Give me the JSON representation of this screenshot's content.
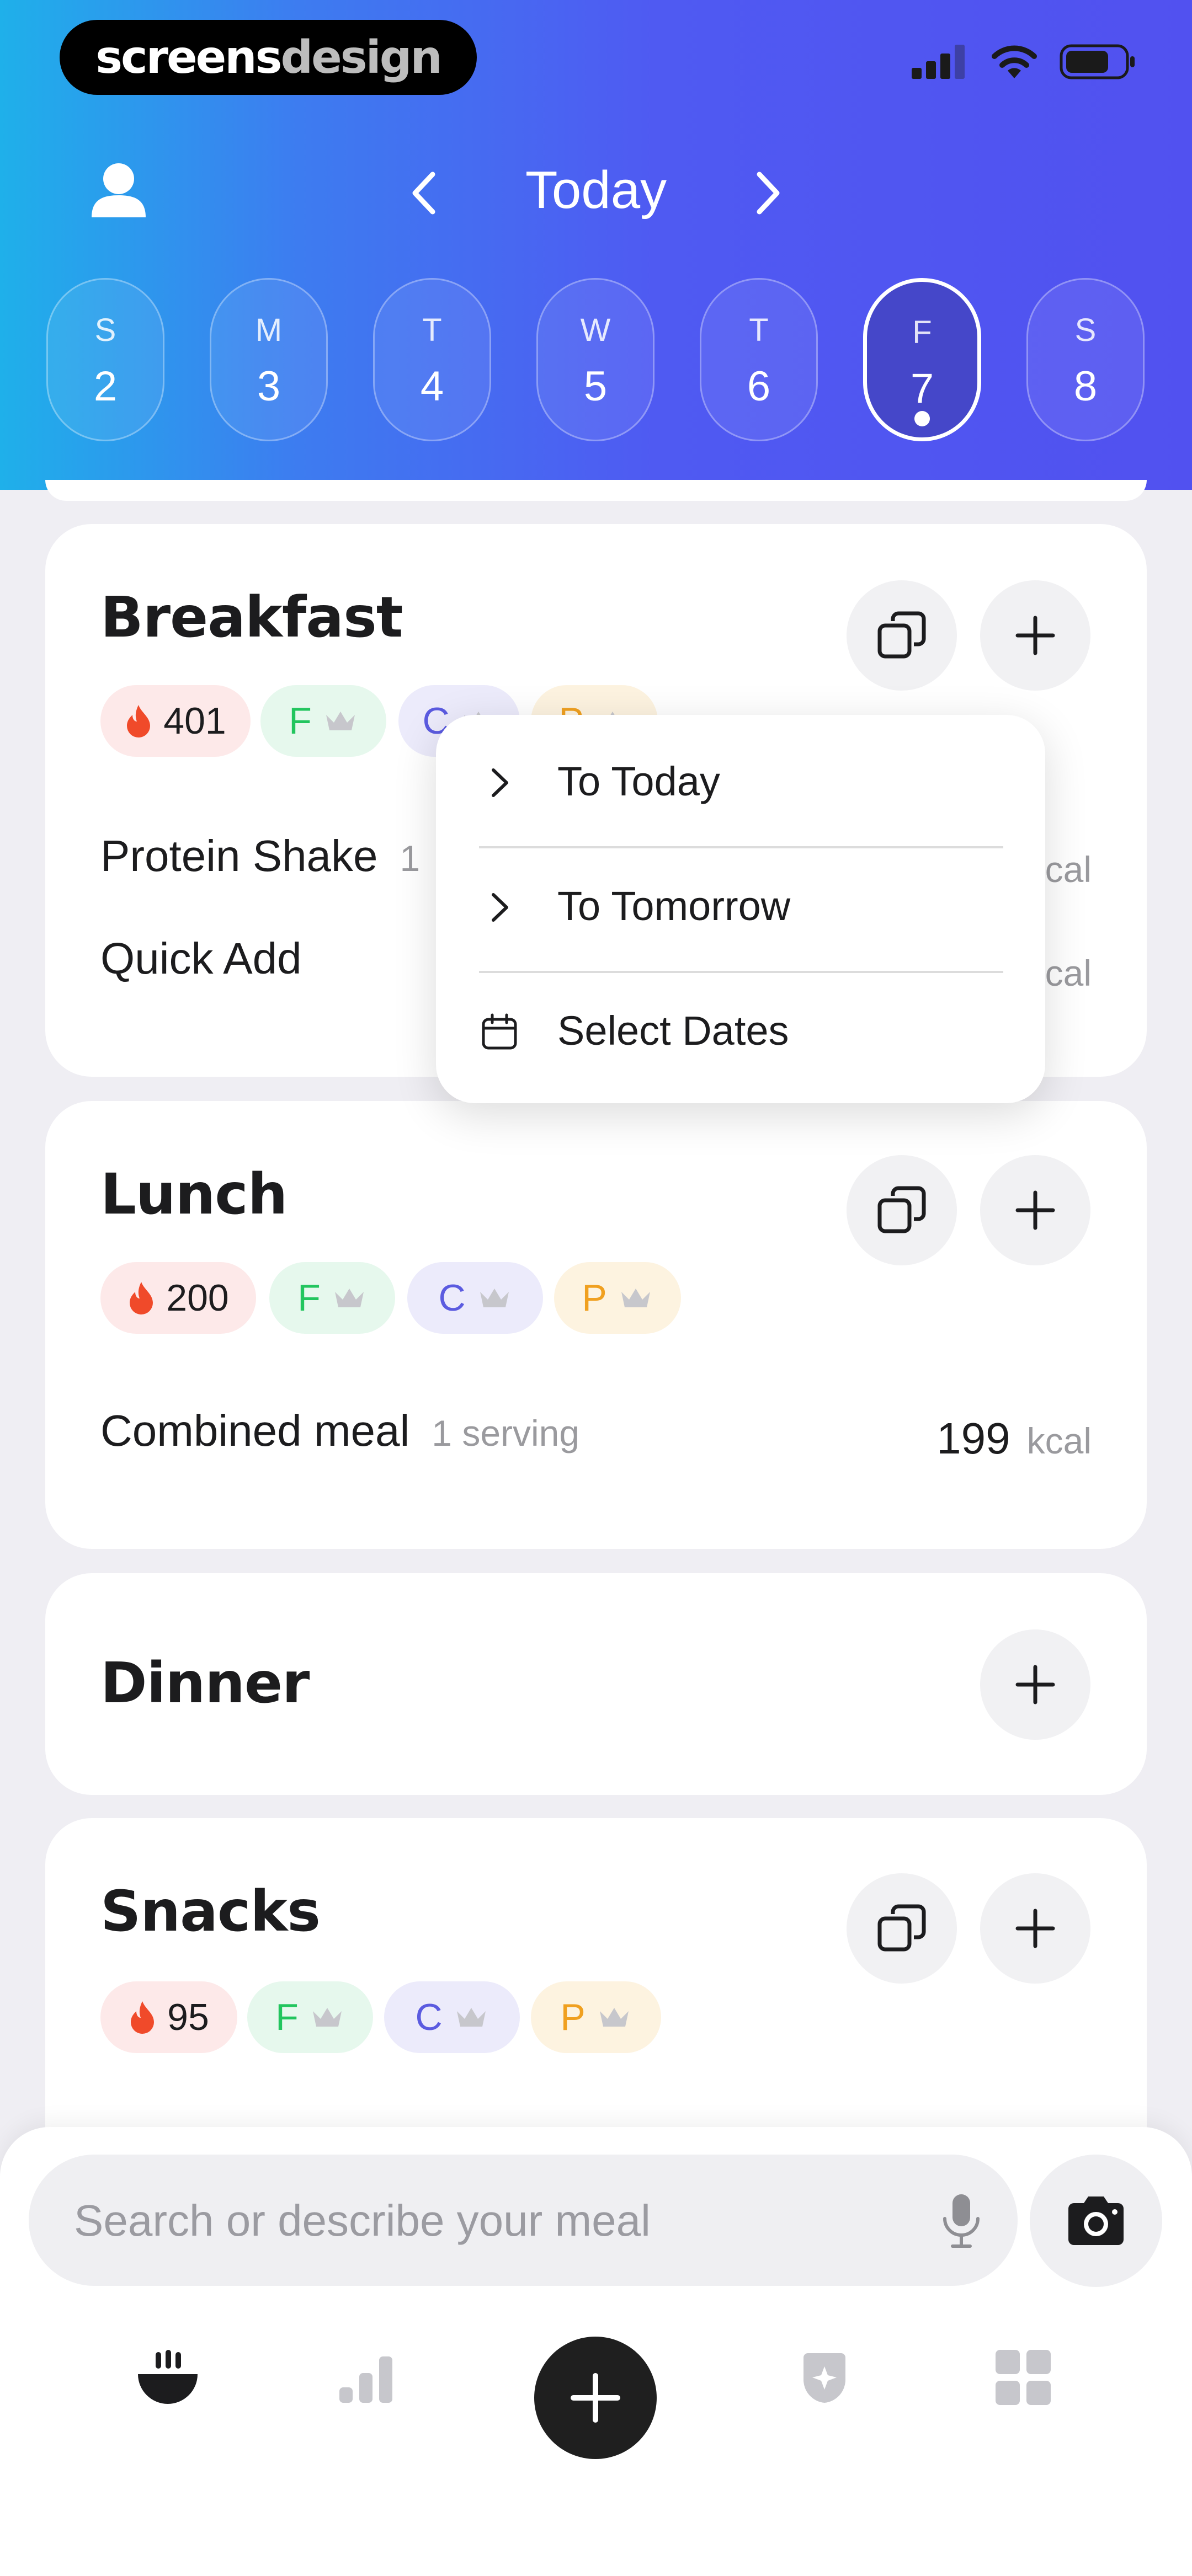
{
  "brand": {
    "part1": "screens",
    "part2": "design"
  },
  "header": {
    "title": "Today"
  },
  "week": [
    {
      "letter": "S",
      "num": "2"
    },
    {
      "letter": "M",
      "num": "3"
    },
    {
      "letter": "T",
      "num": "4"
    },
    {
      "letter": "W",
      "num": "5"
    },
    {
      "letter": "T",
      "num": "6"
    },
    {
      "letter": "F",
      "num": "7",
      "selected": true
    },
    {
      "letter": "S",
      "num": "8"
    }
  ],
  "macro_letters": {
    "f": "F",
    "c": "C",
    "p": "P"
  },
  "meals": {
    "breakfast": {
      "title": "Breakfast",
      "calories": "401",
      "items": [
        {
          "name": "Protein Shake",
          "serving_visible": "1",
          "unit_visible": "cal"
        },
        {
          "name": "Quick Add",
          "unit_visible": "cal"
        }
      ]
    },
    "lunch": {
      "title": "Lunch",
      "calories": "200",
      "items": [
        {
          "name": "Combined meal",
          "serving": "1 serving",
          "kcal": "199",
          "unit": "kcal"
        }
      ]
    },
    "dinner": {
      "title": "Dinner"
    },
    "snacks": {
      "title": "Snacks",
      "calories": "95"
    }
  },
  "copy_menu": {
    "items": [
      "To Today",
      "To Tomorrow",
      "Select Dates"
    ]
  },
  "search": {
    "placeholder": "Search or describe your meal"
  },
  "colors": {
    "header_gradient_start": "#1fb0ea",
    "header_gradient_end": "#5151f0",
    "fat": "#22c55e",
    "carbs": "#5b5be0",
    "protein": "#f0a020",
    "calorie_flame": "#f04a2a"
  },
  "icons": {
    "tabs": [
      "food-bowl-icon",
      "stats-icon",
      "add-icon",
      "badge-icon",
      "grid-icon"
    ]
  }
}
